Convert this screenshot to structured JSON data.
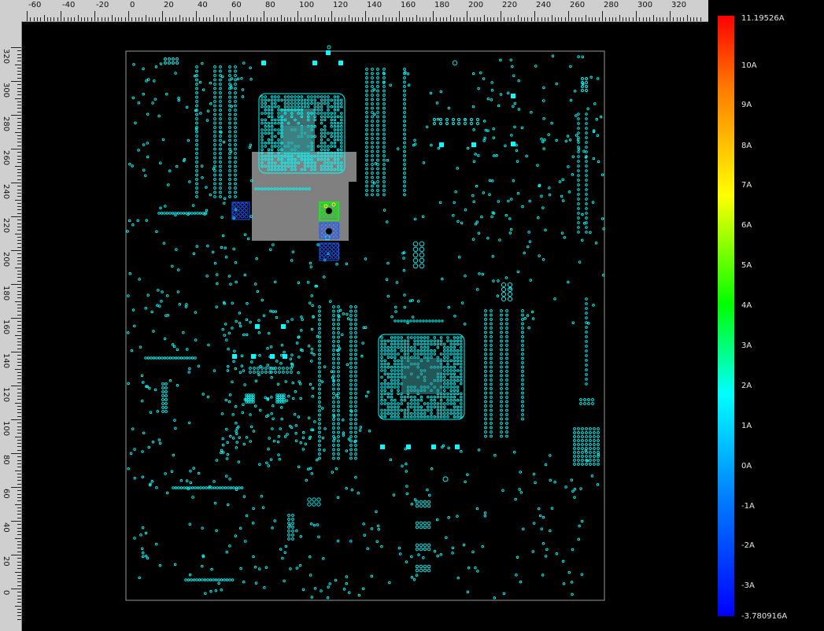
{
  "ruler": {
    "x_labels": [
      "-60",
      "-40",
      "-20",
      "0",
      "20",
      "40",
      "60",
      "80",
      "100",
      "120",
      "140",
      "160",
      "180",
      "200",
      "220",
      "240",
      "260",
      "280",
      "300",
      "320"
    ],
    "y_labels": [
      "320",
      "300",
      "280",
      "260",
      "240",
      "220",
      "200",
      "180",
      "160",
      "140",
      "120",
      "100",
      "80",
      "60",
      "40",
      "20",
      "0"
    ]
  },
  "colorbar": {
    "labels": [
      "11.19526A",
      "10A",
      "9A",
      "8A",
      "7A",
      "6A",
      "5A",
      "4A",
      "3A",
      "2A",
      "1A",
      "0A",
      "-1A",
      "-2A",
      "-3A",
      "-3.780916A"
    ]
  },
  "colors": {
    "trace": "#00ffff",
    "selection": "#808080",
    "board_outline": "#9a9a9a",
    "hot": "#00ff00",
    "negative": "#1e5bff"
  }
}
